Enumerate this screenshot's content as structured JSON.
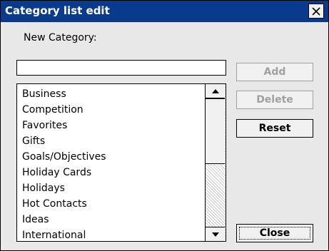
{
  "dialog": {
    "title": "Category list edit",
    "close_icon": "close-icon"
  },
  "new_category": {
    "label": "New Category:",
    "value": ""
  },
  "list": {
    "items": [
      "Business",
      "Competition",
      "Favorites",
      "Gifts",
      "Goals/Objectives",
      "Holiday Cards",
      "Holidays",
      "Hot Contacts",
      "Ideas",
      "International"
    ]
  },
  "buttons": {
    "add": "Add",
    "delete": "Delete",
    "reset": "Reset",
    "close": "Close"
  },
  "colors": {
    "titlebar": "#0a3a8c",
    "disabled_text": "#a0a0a0"
  }
}
